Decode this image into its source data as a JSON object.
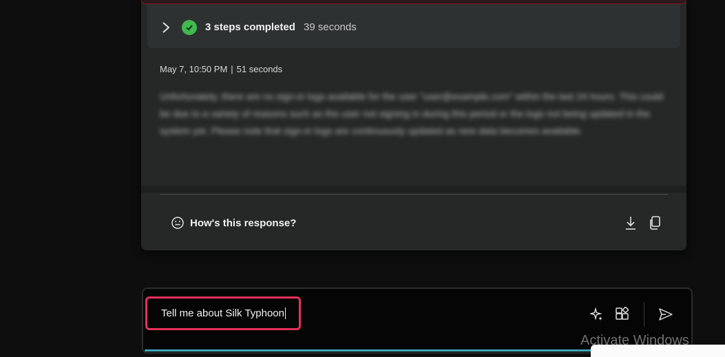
{
  "steps": {
    "label": "3 steps completed",
    "duration": "39 seconds",
    "status_color": "#3fb950"
  },
  "response": {
    "date": "May 7, 10:50 PM",
    "separator": "|",
    "elapsed": "51 seconds",
    "body_blurred": "Unfortunately, there are no sign-in logs available for the user \"user@example.com\" within the last 24 hours. This could be due to a variety of reasons such as the user not signing in during this period or the logs not being updated in the system yet. Please note that sign-in logs are continuously updated as new data becomes available."
  },
  "feedback": {
    "prompt": "How's this response?",
    "icons": [
      "smiley-icon",
      "download-icon",
      "copy-icon"
    ]
  },
  "composer": {
    "input_value": "Tell me about Silk Typhoon",
    "icons": [
      "sparkle-icon",
      "plugins-icon",
      "send-icon"
    ],
    "accent_color": "#3fa9b8",
    "highlight_color": "#e8315a"
  },
  "watermark": {
    "text": "Activate Windows"
  }
}
